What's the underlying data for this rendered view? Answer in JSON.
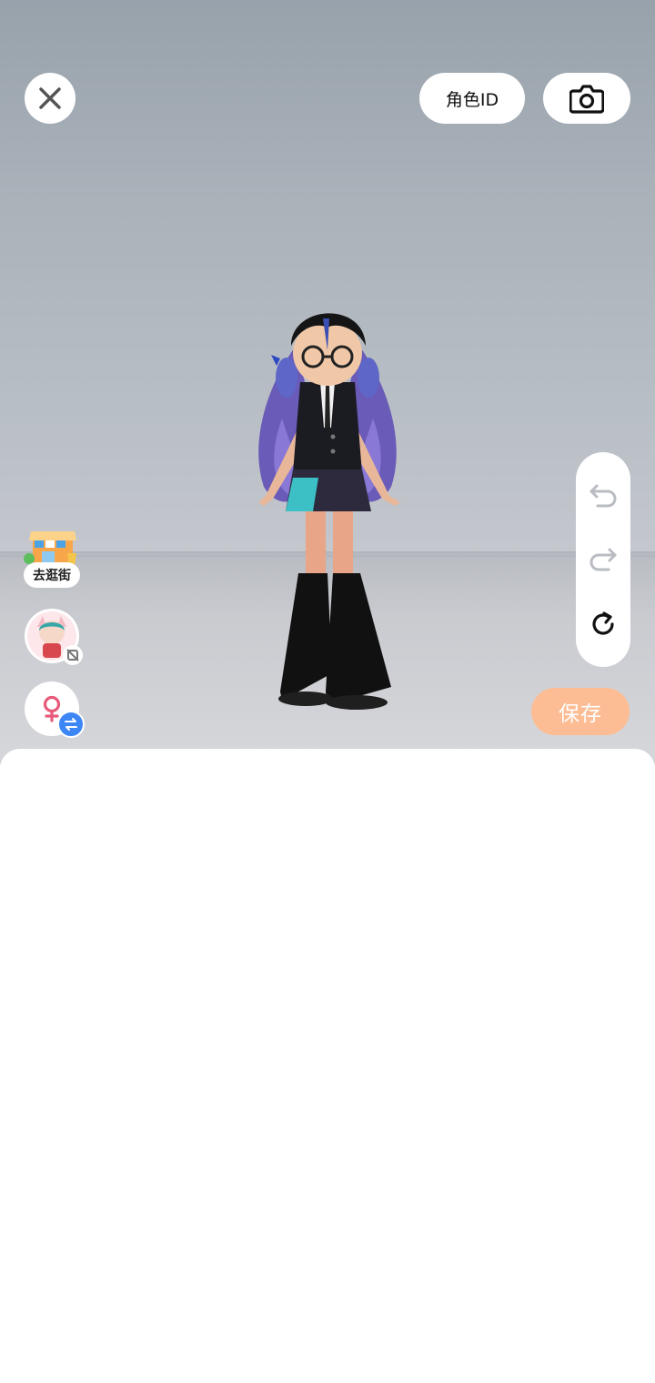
{
  "toolbar": {
    "close_icon": "close-icon",
    "role_id_label": "角色ID",
    "camera_icon": "camera-icon"
  },
  "history": {
    "undo_icon": "undo-icon",
    "redo_icon": "redo-icon",
    "reset_icon": "reset-icon"
  },
  "side_actions": {
    "shop_label": "去逛街",
    "avatar_icon": "avatar-icon",
    "gender_icon": "female-icon",
    "swap_icon": "swap-icon"
  },
  "save_label": "保存",
  "colors": {
    "save_button": "#fdbd94",
    "swap_badge": "#3d86f5",
    "gender_symbol": "#e85a7a"
  }
}
